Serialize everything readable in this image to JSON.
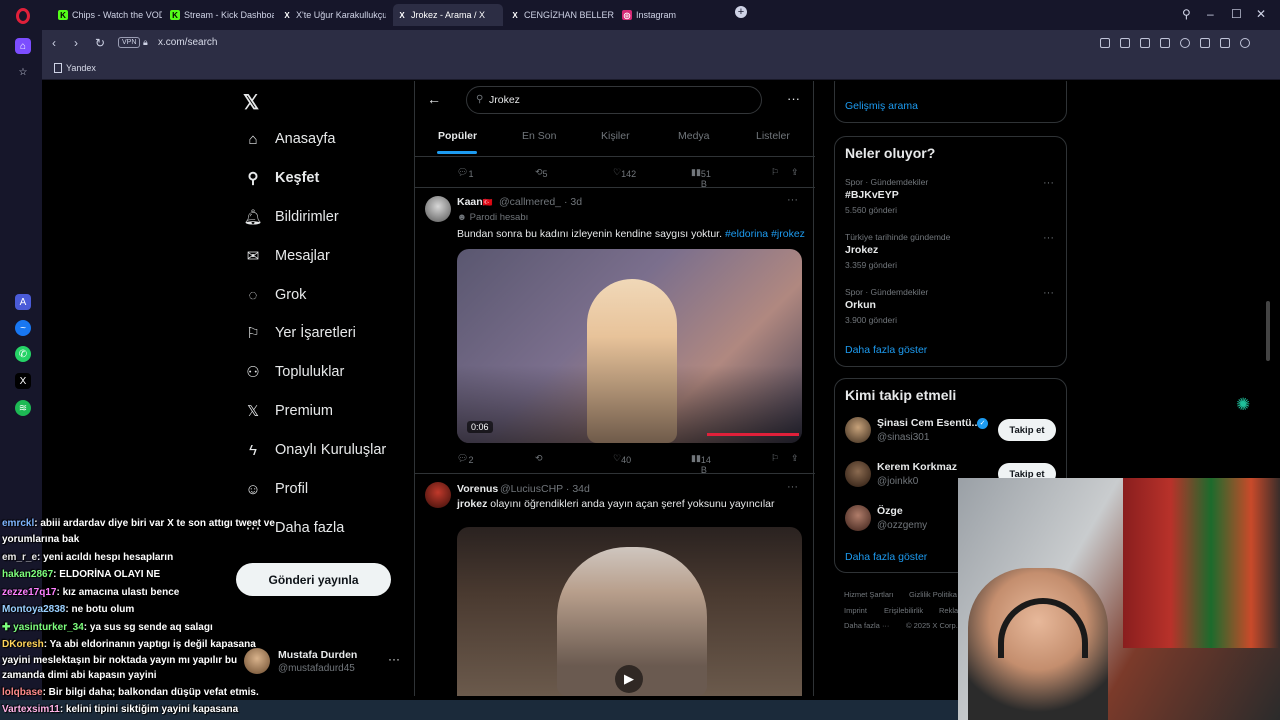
{
  "browser": {
    "tabs": [
      {
        "title": "Chips - Watch the VOD on",
        "icon_color": "#53fc18",
        "icon": "K"
      },
      {
        "title": "Stream - Kick Dashboard",
        "icon_color": "#53fc18",
        "icon": "K"
      },
      {
        "title": "X'te Uğur Karakullukçu: \"K",
        "icon_color": "#000000",
        "icon": "X"
      },
      {
        "title": "Jrokez - Arama / X",
        "icon_color": "#000000",
        "icon": "X"
      },
      {
        "title": "CENGİZHAN BELLER (@ce",
        "icon_color": "#000000",
        "icon": "X"
      },
      {
        "title": "Instagram",
        "icon_color": "#d62976",
        "icon": "◎"
      }
    ],
    "url": "x.com/search",
    "vpn_label": "VPN",
    "bookmarks": [
      {
        "label": "Yandex"
      }
    ]
  },
  "sidebar": {
    "items": [
      {
        "label": "Anasayfa",
        "icon": "home-icon",
        "glyph": "⌂"
      },
      {
        "label": "Keşfet",
        "icon": "search-icon",
        "glyph": "⚲"
      },
      {
        "label": "Bildirimler",
        "icon": "bell-icon",
        "glyph": "🔔︎"
      },
      {
        "label": "Mesajlar",
        "icon": "mail-icon",
        "glyph": "✉"
      },
      {
        "label": "Grok",
        "icon": "grok-icon",
        "glyph": "◌"
      },
      {
        "label": "Yer İşaretleri",
        "icon": "bookmark-icon",
        "glyph": "⚐"
      },
      {
        "label": "Topluluklar",
        "icon": "communities-icon",
        "glyph": "⚇"
      },
      {
        "label": "Premium",
        "icon": "x-logo-icon",
        "glyph": "𝕏"
      },
      {
        "label": "Onaylı Kuruluşlar",
        "icon": "lightning-icon",
        "glyph": "ϟ"
      },
      {
        "label": "Profil",
        "icon": "profile-icon",
        "glyph": "☺"
      },
      {
        "label": "Daha fazla",
        "icon": "more-circle-icon",
        "glyph": "⋯"
      }
    ],
    "post_button": "Gönderi yayınla",
    "account": {
      "name": "Mustafa Durden",
      "handle": "@mustafadurd45"
    }
  },
  "search": {
    "query": "Jrokez",
    "tabs": [
      "Popüler",
      "En Son",
      "Kişiler",
      "Medya",
      "Listeler"
    ]
  },
  "tweets": [
    {
      "stats": {
        "replies": "1",
        "reposts": "5",
        "likes": "142",
        "views": "51 B"
      }
    },
    {
      "name": "Kaan",
      "flag": "🇹🇷",
      "handle": "@callmered_",
      "time": "· 3d",
      "badge": "Parodi hesabı",
      "text": "Bundan sonra bu kadını izleyenin kendine saygısı yoktur.",
      "hashtags": [
        "#eldorina",
        "#jrokez"
      ],
      "video_time": "0:06",
      "stats": {
        "replies": "2",
        "reposts": "",
        "likes": "40",
        "views": "14 B"
      }
    },
    {
      "name": "Vorenus",
      "handle": "@LuciusCHP",
      "time": "· 34d",
      "text_bold": "jrokez",
      "text": " olayını öğrendikleri anda yayın açan şeref yoksunu yayıncılar"
    }
  ],
  "right": {
    "advanced_search": "Gelişmiş arama",
    "trends_title": "Neler oluyor?",
    "trends": [
      {
        "meta": "Spor · Gündemdekiler",
        "name": "#BJKvEYP",
        "count": "5.560 gönderi"
      },
      {
        "meta": "Türkiye tarihinde gündemde",
        "name": "Jrokez",
        "count": "3.359 gönderi"
      },
      {
        "meta": "Spor · Gündemdekiler",
        "name": "Orkun",
        "count": "3.900 gönderi"
      }
    ],
    "show_more": "Daha fazla göster",
    "follow_title": "Kimi takip etmeli",
    "follow": [
      {
        "name": "Şinasi Cem Esentü...",
        "handle": "@sinasi301",
        "verified": true
      },
      {
        "name": "Kerem Korkmaz",
        "handle": "@joinkk0",
        "verified": false
      },
      {
        "name": "Özge",
        "handle": "@ozzgemy",
        "verified": false
      }
    ],
    "follow_button": "Takip et",
    "show_more_2": "Daha fazla göster",
    "footer": [
      "Hizmet Şartları",
      "Gizlilik Politika",
      "Imprint",
      "Erişilebilirlik",
      "Rekla",
      "Daha fazla ···",
      "© 2025 X Corp."
    ]
  },
  "chat": [
    {
      "user": "emrckl",
      "color": "#7fb6ff",
      "msg": ": abiii ardardav diye biri var X te son attıgı tweet ve"
    },
    {
      "user": "",
      "color": "#ffffff",
      "msg": "yorumlarına bak"
    },
    {
      "user": "em_r_e",
      "color": "#e8e8e8",
      "msg": ": yeni acıldı hespı hesapların"
    },
    {
      "user": "hakan2867",
      "color": "#7dff7d",
      "msg": ": ELDORİNA OLAYI NE"
    },
    {
      "user": "zezze17q17",
      "color": "#ff80ff",
      "msg": ": kız amacına ulastı bence"
    },
    {
      "user": "Montoya2838",
      "color": "#9ad0ff",
      "msg": ": ne botu olum"
    },
    {
      "user": "yasinturker_34",
      "color": "#7dff7d",
      "msg": ": ya sus sg sende aq salagı"
    },
    {
      "user": "DKoresh",
      "color": "#ffd35a",
      "msg": ": Ya abi eldorinanın yaptıgı iş değil kapasana"
    },
    {
      "user": "",
      "color": "#ffffff",
      "msg": "yayini meslektaşın bir noktada yayın mı yapılır bu"
    },
    {
      "user": "",
      "color": "#ffffff",
      "msg": "zamanda dimi abi kapasın yayini"
    },
    {
      "user": "lolqbase",
      "color": "#ff8a8a",
      "msg": ": Bir bilgi daha; balkondan düşüp vefat etmis."
    },
    {
      "user": "Vartexsim11",
      "color": "#ffb3e6",
      "msg": ": kelini tipini siktiğim yayini kapasana"
    }
  ],
  "colors": {
    "accent": "#1d9bf0",
    "bg": "#000000",
    "border": "#2f3336",
    "muted": "#71767b"
  }
}
